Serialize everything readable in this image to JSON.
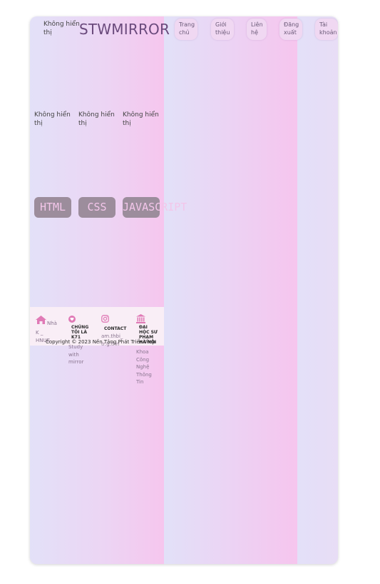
{
  "header": {
    "logo_alt": "Không hiển thị",
    "brand": "STWMIRROR",
    "nav": [
      {
        "label": "Trang chủ"
      },
      {
        "label": "Giới thiệu"
      },
      {
        "label": "Liên hệ"
      },
      {
        "label": "Đăng xuất"
      },
      {
        "label": "Tài khoản"
      }
    ]
  },
  "gallery": [
    {
      "alt": "Không hiển thị"
    },
    {
      "alt": "Không hiển thị"
    },
    {
      "alt": "Không hiển thị"
    }
  ],
  "languages": [
    {
      "label": "HTML"
    },
    {
      "label": "CSS"
    },
    {
      "label": "JAVASCRIPT"
    }
  ],
  "footer": {
    "home": {
      "icon": "home-icon",
      "title": "Nhà",
      "text": "K _ HNUE"
    },
    "about": {
      "icon": "heart-icon",
      "title": "CHÚNG TÔI LÀ K71",
      "text": "Study with mirror"
    },
    "contact": {
      "icon": "instagram-icon",
      "title": "CONTACT",
      "text": "am.thbi_ tr.g.thn"
    },
    "school": {
      "icon": "university-icon",
      "title": "ĐẠI HỌC SƯ PHẠM HÀ NỘI",
      "text": "Khoa Công Nghệ Thông Tin"
    },
    "copyright": "Copyright © 2023 Nền Tảng Phát Triển Web",
    "accent_color": "#e07ab6"
  }
}
